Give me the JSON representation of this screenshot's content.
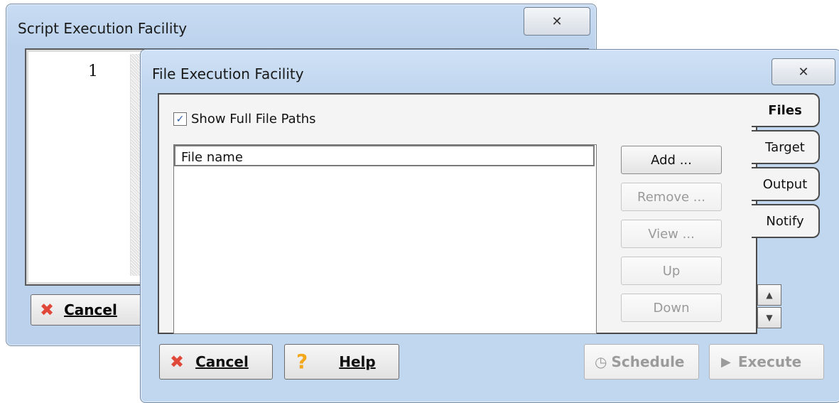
{
  "back_window": {
    "title": "Script Execution Facility",
    "close_glyph": "✕",
    "line_number": "1",
    "cancel_label": "Cancel"
  },
  "front_window": {
    "title": "File Execution Facility",
    "close_glyph": "✕",
    "show_full_paths": {
      "label": "Show Full File Paths",
      "checked": true
    },
    "list": {
      "column_header": "File name",
      "rows": []
    },
    "side_buttons": {
      "add": "Add ...",
      "remove": "Remove ...",
      "view": "View ...",
      "up": "Up",
      "down": "Down"
    },
    "tabs": [
      {
        "label": "Files",
        "active": true
      },
      {
        "label": "Target",
        "active": false
      },
      {
        "label": "Output",
        "active": false
      },
      {
        "label": "Notify",
        "active": false
      }
    ],
    "bottom_buttons": {
      "cancel": "Cancel",
      "help": "Help",
      "schedule": "Schedule",
      "execute": "Execute"
    },
    "icons": {
      "cancel_x_color": "#e0483a",
      "help_question_color": "#f2a71c"
    }
  }
}
